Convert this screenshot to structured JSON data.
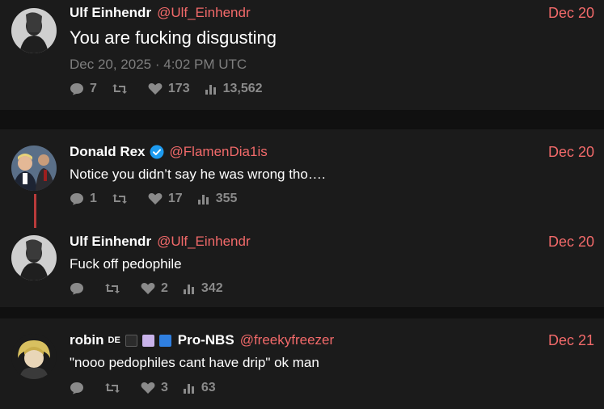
{
  "posts": [
    {
      "author": "Ulf Einhendr",
      "handle": "@Ulf_Einhendr",
      "date": "Dec 20",
      "text": "You are fucking disgusting",
      "timestamp": "Dec 20, 2025 · 4:02 PM UTC",
      "replies": "7",
      "retweets": "",
      "likes": "173",
      "views": "13,562"
    },
    {
      "author": "Donald Rex",
      "handle": "@FlamenDia1is",
      "date": "Dec 20",
      "text": "Notice you didn’t say he was wrong tho….",
      "replies": "1",
      "retweets": "",
      "likes": "17",
      "views": "355",
      "verified": true
    },
    {
      "author": "Ulf Einhendr",
      "handle": "@Ulf_Einhendr",
      "date": "Dec 20",
      "text": "Fuck off pedophile",
      "replies": "",
      "retweets": "",
      "likes": "2",
      "views": "342"
    },
    {
      "author": "robin",
      "author_flag": "DE",
      "author_suffix": "Pro-NBS",
      "handle": "@freekyfreezer",
      "date": "Dec 21",
      "text": "\"nooo pedophiles cant have drip\" ok man",
      "replies": "",
      "retweets": "",
      "likes": "3",
      "views": "63"
    }
  ],
  "colors": {
    "background": "#1b1b1b",
    "separator": "#101010",
    "accent": "#f26a6a",
    "thread_line": "#b83a3a",
    "muted": "#8a8a8a",
    "verified": "#1d9bf0"
  },
  "icons": {
    "reply": "speech-bubble-icon",
    "retweet": "retweet-icon",
    "like": "heart-icon",
    "views": "bar-chart-icon",
    "verified": "verified-badge-icon"
  }
}
